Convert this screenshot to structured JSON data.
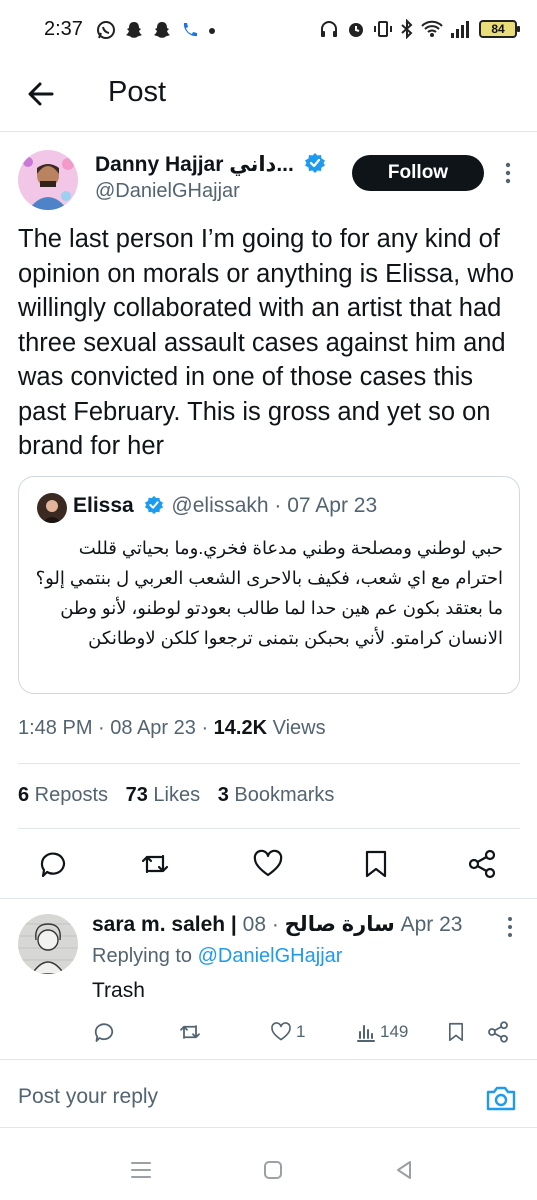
{
  "status_bar": {
    "time": "2:37",
    "battery": "84",
    "icons": [
      "whatsapp-icon",
      "snapchat-icon",
      "snapchat-icon",
      "phone-icon",
      "dot-icon",
      "headphones-icon",
      "alarm-icon",
      "vibrate-icon",
      "bluetooth-icon",
      "wifi-icon",
      "signal-icon",
      "battery-icon"
    ]
  },
  "header": {
    "title": "Post"
  },
  "post": {
    "author_name": "Danny Hajjar داني...",
    "author_handle": "@DanielGHajjar",
    "follow_label": "Follow",
    "text": "The last person I’m going to for any kind of opinion on morals or anything is Elissa, who willingly collaborated with an artist that had three sexual assault cases against him and was convicted in one of those cases this past February. This is gross and yet so on brand for her",
    "quote": {
      "name": "Elissa",
      "meta": "@elissakh · 07 Apr 23",
      "text": "حبي لوطني ومصلحة وطني مدعاة فخري.وما بحياتي قللت احترام مع اي شعب، فكيف بالاحرى الشعب العربي ل بنتمي إلو؟ما بعتقد بكون عم هين حدا لما طالب بعودتو لوطنو، لأنو وطن الانسان كرامتو. لأني بحبكن بتمنى ترجعوا كلكن لاوطانكن"
    },
    "timestamp": "1:48 PM · 08 Apr 23 · ",
    "views_count": "14.2K",
    "views_label": " Views",
    "stats": {
      "reposts_count": "6",
      "reposts_label": " Reposts",
      "likes_count": "73",
      "likes_label": " Likes",
      "bookmarks_count": "3",
      "bookmarks_label": " Bookmarks"
    }
  },
  "reply": {
    "name": "sara m. saleh | سارة صالح",
    "meta": " · 08 Apr 23",
    "replying_prefix": "Replying to ",
    "replying_handle": "@DanielGHajjar",
    "text": "Trash",
    "likes": "1",
    "views": "149"
  },
  "compose": {
    "placeholder": "Post your reply"
  },
  "colors": {
    "accent": "#1d9bf0",
    "text": "#0f1419",
    "muted": "#536471",
    "divider": "#e2e6ea"
  }
}
